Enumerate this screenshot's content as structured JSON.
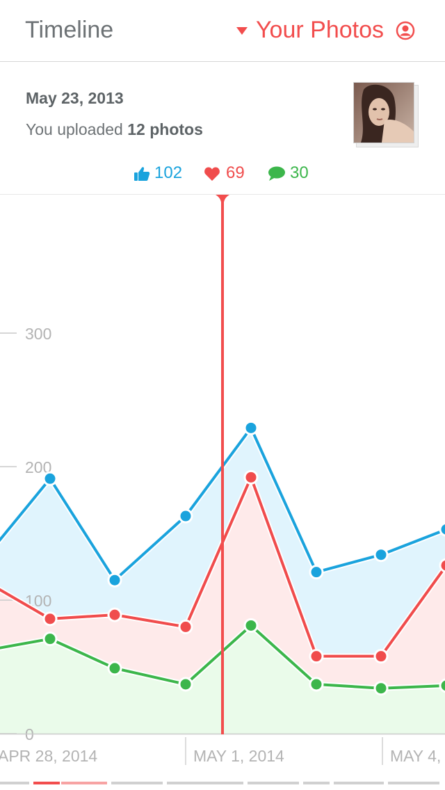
{
  "header": {
    "title": "Timeline",
    "photos_label": "Your Photos"
  },
  "card": {
    "date": "May 23, 2013",
    "upload_prefix": "You uploaded ",
    "upload_count": "12 photos",
    "likes": "102",
    "hearts": "69",
    "comments": "30"
  },
  "icons": {
    "caret": "caret-down-icon",
    "user": "user-circle-icon",
    "like": "thumbs-up-icon",
    "heart": "heart-icon",
    "comment": "comment-icon"
  },
  "colors": {
    "accent_red": "#f24d4d",
    "blue": "#1aa3dd",
    "red": "#f04c4c",
    "green": "#3cb64b",
    "blue_fill": "#e0f4fd",
    "red_fill": "#feeaea",
    "green_fill": "#eafbea"
  },
  "chart_data": {
    "type": "area",
    "ytick_labels": [
      "0",
      "100",
      "200",
      "300"
    ],
    "x_labels": [
      "APR 28, 2014",
      "MAY 1, 2014",
      "MAY 4, 2014"
    ],
    "ylim": [
      0,
      400
    ],
    "series": [
      {
        "color": "#1aa3dd",
        "values": [
          130,
          191,
          115,
          163,
          229,
          121,
          134,
          153
        ]
      },
      {
        "color": "#f04c4c",
        "values": [
          115,
          86,
          89,
          80,
          192,
          58,
          58,
          126
        ]
      },
      {
        "color": "#3cb64b",
        "values": [
          62,
          71,
          49,
          37,
          81,
          37,
          34,
          36
        ]
      }
    ]
  },
  "pager": {
    "active_index": 1
  }
}
